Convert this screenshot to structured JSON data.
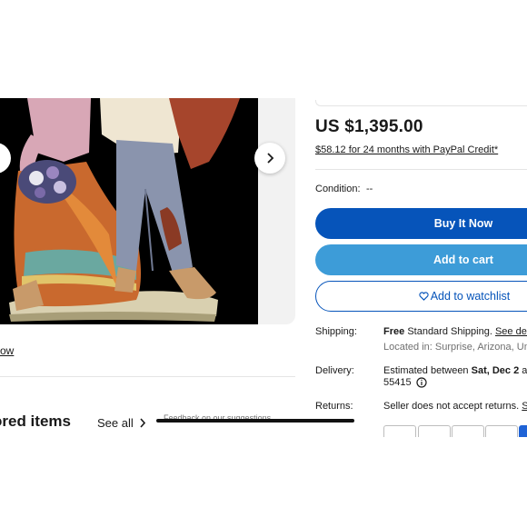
{
  "gallery": {
    "image_alt": "Porcelain figurine of a couple",
    "prev_icon": "chevron-left-icon",
    "next_icon": "chevron-right-icon"
  },
  "left": {
    "view_link": "ow",
    "sponsored_title": "ored items",
    "see_all": "See all",
    "feedback": "Feedback on our suggestions"
  },
  "listing": {
    "price": "US $1,395.00",
    "credit_offer": "$58.12 for 24 months with PayPal Credit*",
    "condition_label": "Condition:",
    "condition_value": "--",
    "buy_now": "Buy It Now",
    "add_to_cart": "Add to cart",
    "watchlist": "Add to watchlist",
    "shipping_label": "Shipping:",
    "shipping_free": "Free",
    "shipping_service": "Standard Shipping.",
    "shipping_details_link": "See deta",
    "located_in": "Located in: Surprise, Arizona, Unit",
    "delivery_label": "Delivery:",
    "delivery_prefix": "Estimated between",
    "delivery_dates": "Sat, Dec 2",
    "delivery_and": "and",
    "delivery_zip": "55415",
    "returns_label": "Returns:",
    "returns_text": "Seller does not accept returns.",
    "returns_link": "Se"
  },
  "colors": {
    "primary_blue": "#0654ba",
    "cart_blue": "#3d9cd8"
  }
}
